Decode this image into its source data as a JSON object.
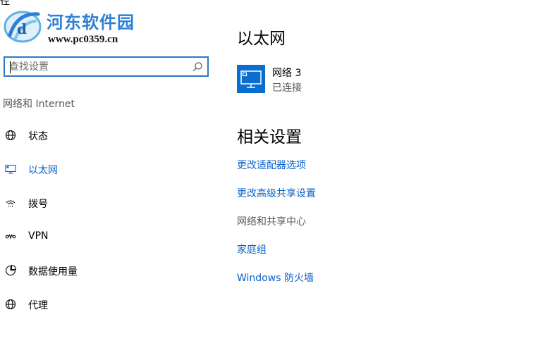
{
  "watermark": {
    "title": "河东软件园",
    "url": "www.pc0359.cn"
  },
  "top_glyph": "径",
  "search": {
    "placeholder": "查找设置",
    "value": ""
  },
  "sidebar": {
    "section_label": "网络和 Internet",
    "items": [
      {
        "label": "状态",
        "icon": "globe-icon",
        "active": false
      },
      {
        "label": "以太网",
        "icon": "ethernet-icon",
        "active": true
      },
      {
        "label": "拨号",
        "icon": "dialup-icon",
        "active": false
      },
      {
        "label": "VPN",
        "icon": "vpn-icon",
        "active": false
      },
      {
        "label": "数据使用量",
        "icon": "data-usage-icon",
        "active": false
      },
      {
        "label": "代理",
        "icon": "globe-icon",
        "active": false
      }
    ]
  },
  "main": {
    "title": "以太网",
    "network": {
      "name": "网络  3",
      "status": "已连接",
      "icon": "monitor-network-icon"
    },
    "related_title": "相关设置",
    "related_links": [
      {
        "label": "更改适配器选项"
      },
      {
        "label": "更改高级共享设置"
      },
      {
        "label": "网络和共享中心"
      },
      {
        "label": "家庭组"
      },
      {
        "label": "Windows 防火墙"
      }
    ]
  },
  "colors": {
    "accent": "#0a62c9",
    "search_border": "#2b78c8",
    "icon_tile": "#0a6ed1",
    "watermark_blue": "#2f7fd6"
  }
}
